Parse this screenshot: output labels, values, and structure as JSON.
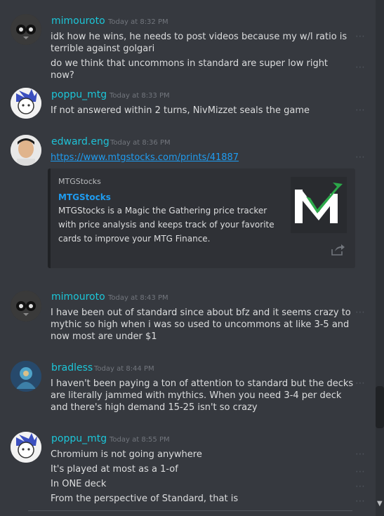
{
  "messages": [
    {
      "user": "mimouroto",
      "time": "Today at 8:32 PM",
      "lines": [
        "idk how he wins, he needs to post videos because my w/l ratio is terrible against golgari",
        "do we think that uncommons in standard are super low right now?"
      ]
    },
    {
      "user": "poppu_mtg",
      "time": "Today at 8:33 PM",
      "lines": [
        "If not answered within 2 turns, NivMizzet seals the game"
      ]
    },
    {
      "user": "edward.eng",
      "time": "Today at 8:36 PM",
      "link": "https://www.mtgstocks.com/prints/41887",
      "embed": {
        "provider": "MTGStocks",
        "title": "MTGStocks",
        "desc": "MTGStocks is a Magic the Gathering price tracker with price analysis and keeps track of your favorite cards to improve your MTG Finance."
      }
    },
    {
      "user": "mimouroto",
      "time": "Today at 8:43 PM",
      "lines": [
        "I have been out of standard since about bfz and it seems crazy to mythic so high when i was so used to uncommons at like 3-5 and now most are under $1"
      ]
    },
    {
      "user": "bradless",
      "time": "Today at 8:44 PM",
      "lines": [
        "I haven't been paying a ton of attention to standard but the decks are literally jammed with mythics. When you need 3-4 per deck and there's high demand 15-25 isn't so crazy"
      ]
    },
    {
      "user": "poppu_mtg",
      "time": "Today at 8:55 PM",
      "lines": [
        "Chromium is not going anywhere",
        "It's played at most as a 1-of",
        "In ONE deck",
        "From the perspective of Standard, that is"
      ]
    }
  ],
  "icons": {
    "more": "more-dots-icon",
    "share": "share-icon"
  }
}
